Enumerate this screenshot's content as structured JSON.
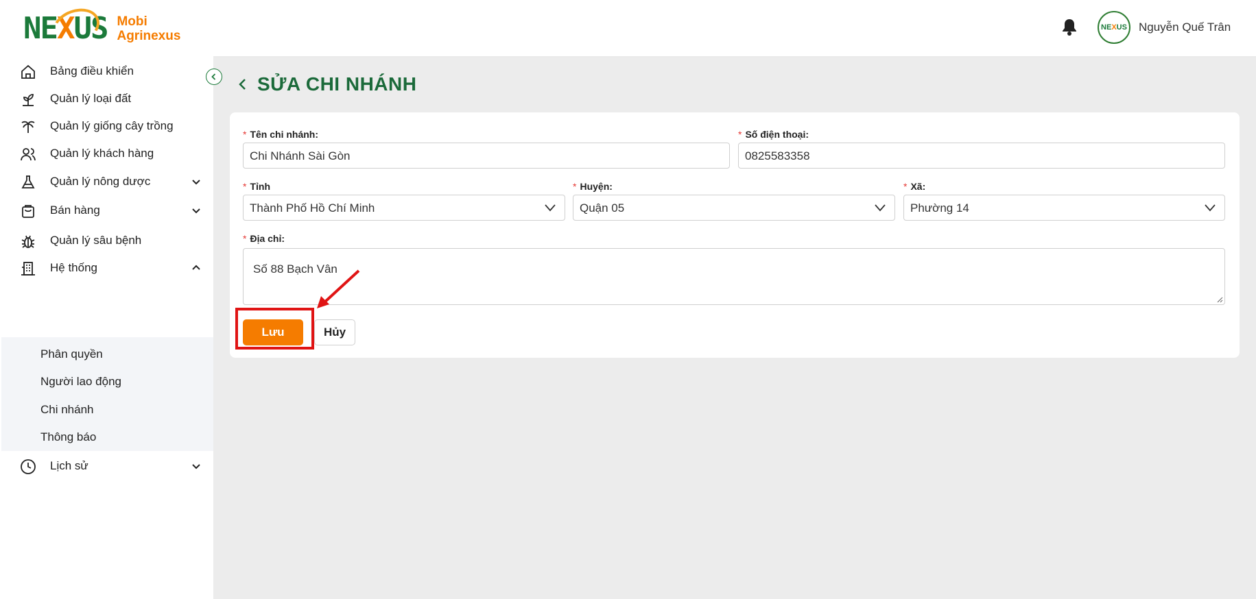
{
  "app": {
    "logo_mark_a": "NE",
    "logo_mark_x": "X",
    "logo_mark_b": "US",
    "brand_line1": "Mobi",
    "brand_line2": "Agrinexus",
    "brand_color": "#f57c00",
    "primary_color": "#1b6a3a"
  },
  "header": {
    "notification_icon": "bell-icon",
    "avatar_mark_a": "NE",
    "avatar_mark_x": "X",
    "avatar_mark_b": "US",
    "user_name": "Nguyễn Quế Trân"
  },
  "sidebar": {
    "items": [
      {
        "label": "Bảng điều khiển",
        "icon": "home-icon"
      },
      {
        "label": "Quản lý loại đất",
        "icon": "sprout-icon"
      },
      {
        "label": "Quản lý giống cây trồng",
        "icon": "palm-tree-icon"
      },
      {
        "label": "Quản lý khách hàng",
        "icon": "users-icon"
      },
      {
        "label": "Quản lý nông dược",
        "icon": "flask-icon"
      },
      {
        "label": "Bán hàng",
        "icon": "shopping-bag-icon"
      },
      {
        "label": "Quản lý sâu bệnh",
        "icon": "bug-icon"
      },
      {
        "label": "Hệ thống",
        "icon": "building-icon"
      },
      {
        "label": "Lịch sử",
        "icon": "clock-icon"
      }
    ],
    "submenu": [
      {
        "label": "Phân quyền"
      },
      {
        "label": "Người lao động"
      },
      {
        "label": "Chi nhánh"
      },
      {
        "label": "Thông báo"
      }
    ]
  },
  "page": {
    "title": "SỬA CHI NHÁNH"
  },
  "form": {
    "name": {
      "label": "Tên chi nhánh:",
      "value": "Chi Nhánh Sài Gòn"
    },
    "phone": {
      "label": "Số điện thoại:",
      "value": "0825583358"
    },
    "province": {
      "label": "Tỉnh",
      "value": "Thành Phố Hồ Chí Minh"
    },
    "district": {
      "label": "Huyện:",
      "value": "Quận 05"
    },
    "ward": {
      "label": "Xã:",
      "value": "Phường 14"
    },
    "address": {
      "label": "Địa chỉ:",
      "value": "Số 88 Bạch Vân"
    },
    "required_mark": "*",
    "save_label": "Lưu",
    "cancel_label": "Hủy"
  }
}
